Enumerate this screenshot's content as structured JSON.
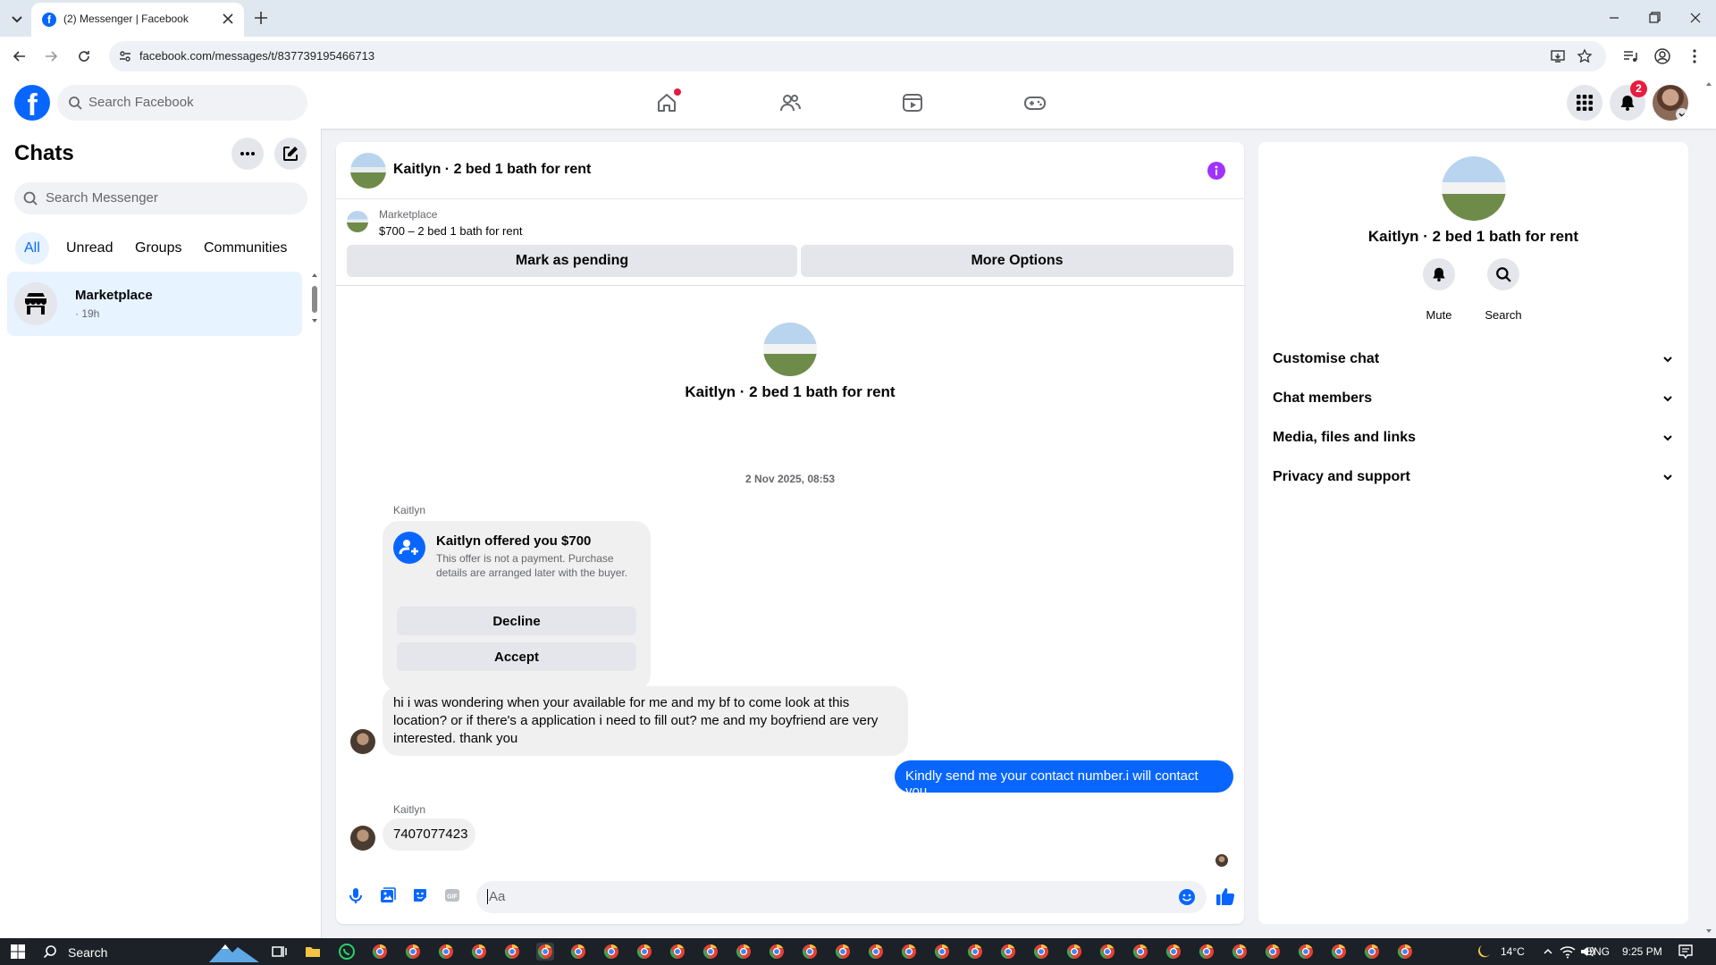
{
  "browser": {
    "tab_title": "(2) Messenger | Facebook",
    "url": "facebook.com/messages/t/837739195466713"
  },
  "header": {
    "search_placeholder": "Search Facebook",
    "notification_count": "2"
  },
  "sidebar": {
    "title": "Chats",
    "search_placeholder": "Search Messenger",
    "filters": [
      "All",
      "Unread",
      "Groups",
      "Communities"
    ],
    "chats": [
      {
        "name": "Marketplace",
        "time": "· 19h"
      }
    ]
  },
  "conversation": {
    "title": "Kaitlyn · 2 bed 1 bath for rent",
    "listing": {
      "label": "Marketplace",
      "detail": "$700 – 2 bed 1 bath for rent"
    },
    "buttons": {
      "mark_pending": "Mark as pending",
      "more_options": "More Options"
    },
    "intro_name": "Kaitlyn · 2 bed 1 bath for rent",
    "date": "2 Nov 2025, 08:53",
    "messages": [
      {
        "sender": "Kaitlyn",
        "offer_title": "Kaitlyn offered you $700",
        "offer_note": "This offer is not a payment. Purchase details are arranged later with the buyer.",
        "decline": "Decline",
        "accept": "Accept"
      },
      {
        "text": "hi i was wondering when your available for me and my bf to come look at this location? or if there's a application i need to fill out? me and my boyfriend are very interested. thank you"
      },
      {
        "text": "Kindly send me your contact number.i will contact you",
        "outgoing": true
      },
      {
        "sender": "Kaitlyn",
        "text": "7407077423"
      }
    ],
    "composer_placeholder": "Aa"
  },
  "details": {
    "name": "Kaitlyn · 2 bed 1 bath for rent",
    "actions": [
      "Mute",
      "Search"
    ],
    "sections": [
      "Customise chat",
      "Chat members",
      "Media, files and links",
      "Privacy and support"
    ]
  },
  "taskbar": {
    "search": "Search",
    "temperature": "14°C",
    "language": "ENG",
    "time": "9:25 PM"
  },
  "colors": {
    "brand": "#0866ff",
    "badge": "#e41e3f",
    "info": "#a033ff"
  }
}
